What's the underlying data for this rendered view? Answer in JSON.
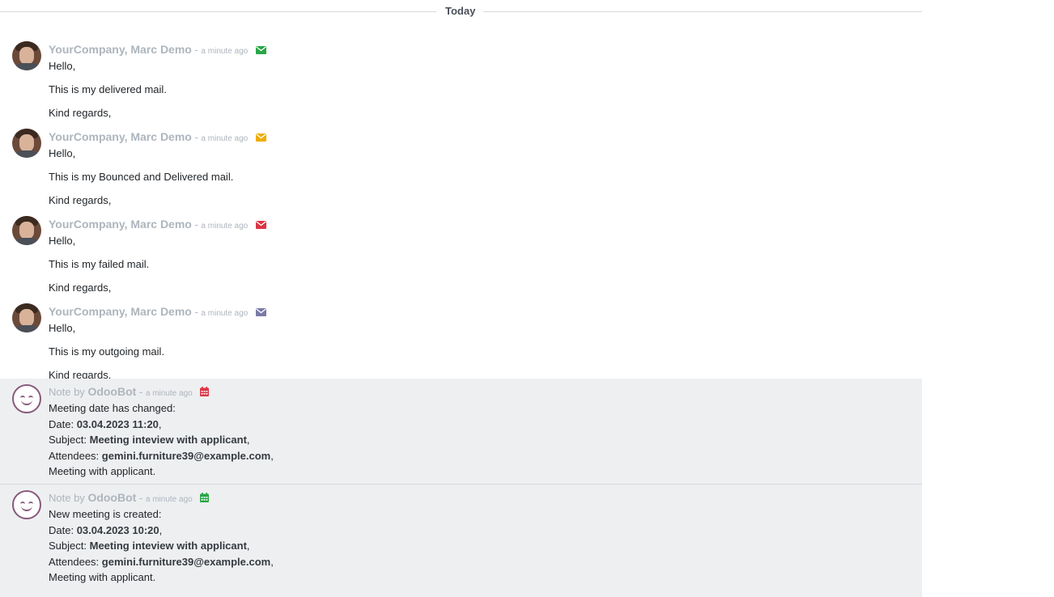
{
  "separator": {
    "label": "Today"
  },
  "messages": [
    {
      "author": "YourCompany, Marc Demo",
      "time": "a minute ago",
      "status_icon": "envelope-icon",
      "status_color": "#28a745",
      "greeting": "Hello,",
      "text": "This is my delivered mail.",
      "closing": "Kind regards,"
    },
    {
      "author": "YourCompany, Marc Demo",
      "time": "a minute ago",
      "status_icon": "envelope-icon",
      "status_color": "#f0ad00",
      "greeting": "Hello,",
      "text": "This is my Bounced and Delivered mail.",
      "closing": "Kind regards,"
    },
    {
      "author": "YourCompany, Marc Demo",
      "time": "a minute ago",
      "status_icon": "envelope-icon",
      "status_color": "#dc3545",
      "greeting": "Hello,",
      "text": "This is my failed mail.",
      "closing": "Kind regards,"
    },
    {
      "author": "YourCompany, Marc Demo",
      "time": "a minute ago",
      "status_icon": "envelope-icon",
      "status_color": "#7a79a8",
      "greeting": "Hello,",
      "text": "This is my outgoing mail.",
      "closing": "Kind regards,"
    }
  ],
  "notes": [
    {
      "prefix": "Note by",
      "author": "OdooBot",
      "time": "a minute ago",
      "icon": "calendar-icon",
      "icon_color": "#dc3545",
      "headline": "Meeting date has changed:",
      "date_label": "Date:",
      "date_value": "03.04.2023 11:20",
      "subject_label": "Subject:",
      "subject_value": "Meeting inteview with applicant",
      "attendees_label": "Attendees:",
      "attendees_value": "gemini.furniture39@example.com",
      "description": "Meeting with applicant."
    },
    {
      "prefix": "Note by",
      "author": "OdooBot",
      "time": "a minute ago",
      "icon": "calendar-icon",
      "icon_color": "#28a745",
      "headline": "New meeting is created:",
      "date_label": "Date:",
      "date_value": "03.04.2023 10:20",
      "subject_label": "Subject:",
      "subject_value": "Meeting inteview with applicant",
      "attendees_label": "Attendees:",
      "attendees_value": "gemini.furniture39@example.com",
      "description": "Meeting with applicant."
    }
  ],
  "separators": {
    "dash": " - ",
    "comma": ","
  }
}
